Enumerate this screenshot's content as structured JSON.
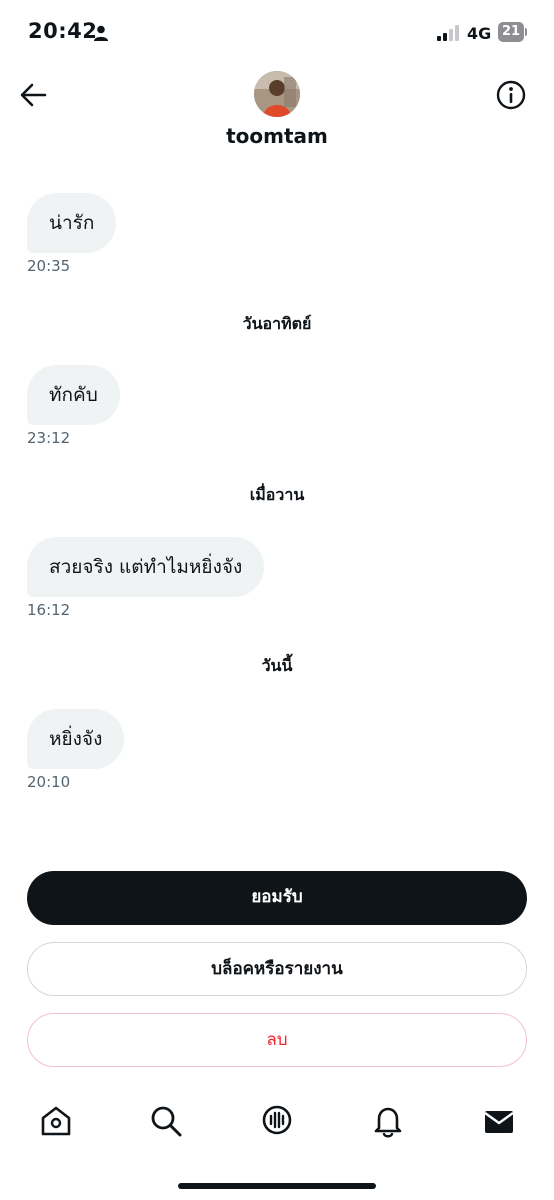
{
  "status_bar": {
    "time": "20:42",
    "network": "4G",
    "battery": "21",
    "person_icon": "person-icon",
    "signal_icon": "signal-icon"
  },
  "header": {
    "username": "toomtam",
    "back_icon": "arrow-left-icon",
    "info_icon": "info-icon"
  },
  "messages": [
    {
      "text": "น่ารัก",
      "time": "20:35"
    },
    {
      "text": "ทักคับ",
      "time": "23:12"
    },
    {
      "text": "สวยจริง แต่ทำไมหยิ่งจัง",
      "time": "16:12"
    },
    {
      "text": "หยิ่งจัง",
      "time": "20:10"
    }
  ],
  "date_separators": [
    "วันอาทิตย์",
    "เมื่อวาน",
    "วันนี้"
  ],
  "actions": {
    "accept": "ยอมรับ",
    "block_report": "บล็อคหรือรายงาน",
    "delete": "ลบ"
  },
  "nav": [
    "home-icon",
    "search-icon",
    "spaces-icon",
    "bell-icon",
    "mail-icon"
  ],
  "colors": {
    "bubble": "#eff3f4",
    "timestamp": "#536471",
    "primary_button": "#0f1419",
    "delete_text": "#f4212e"
  }
}
